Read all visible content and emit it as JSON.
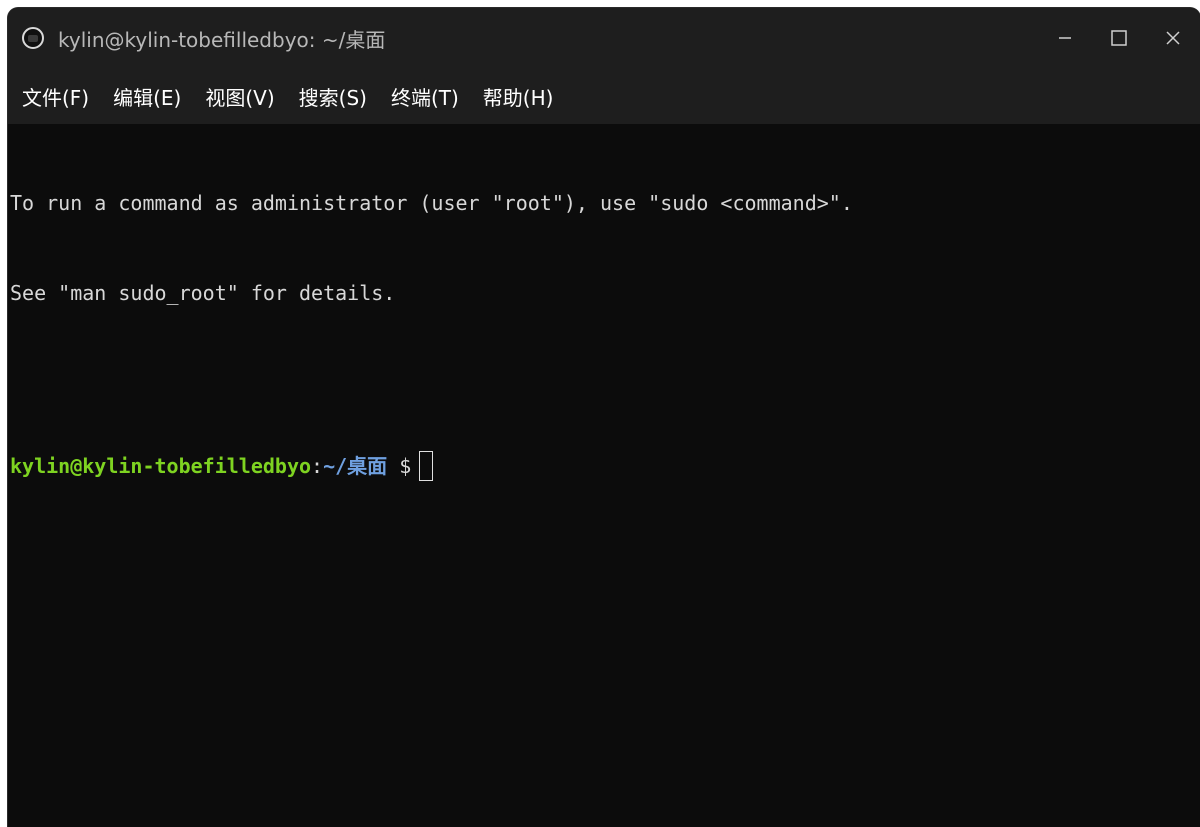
{
  "window": {
    "title": "kylin@kylin-tobefilledbyo: ~/桌面",
    "icon": "terminal-icon",
    "controls": [
      "minimize-icon",
      "maximize-icon",
      "close-icon"
    ]
  },
  "menubar": {
    "items": [
      {
        "label": "文件(F)"
      },
      {
        "label": "编辑(E)"
      },
      {
        "label": "视图(V)"
      },
      {
        "label": "搜索(S)"
      },
      {
        "label": "终端(T)"
      },
      {
        "label": "帮助(H)"
      }
    ]
  },
  "terminal": {
    "lines": [
      "To run a command as administrator (user \"root\"), use \"sudo <command>\".",
      "See \"man sudo_root\" for details."
    ],
    "prompt": {
      "user_host": "kylin@kylin-tobefilledbyo",
      "colon": ":",
      "path": "~/桌面",
      "sign": " $"
    }
  },
  "colors": {
    "background": "#0c0c0c",
    "titlebar": "#1e1e1e",
    "prompt_user": "#7ed321",
    "prompt_path": "#6fa0e0",
    "text": "#d8d8d8"
  }
}
